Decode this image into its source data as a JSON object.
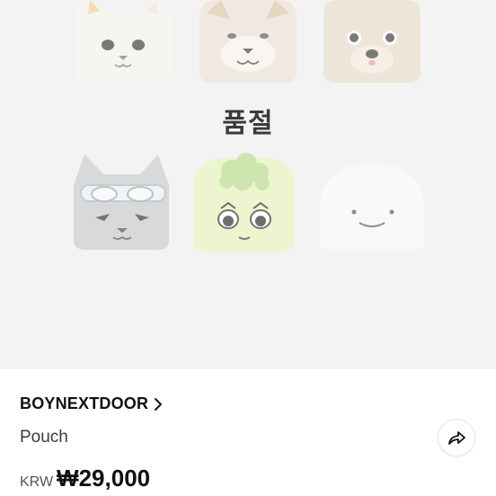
{
  "product": {
    "soldout_label": "품절",
    "brand": "BOYNEXTDOOR",
    "name": "Pouch",
    "currency": "KRW",
    "price": "₩29,000"
  },
  "icons": {
    "brand_chevron": "chevron-right-icon",
    "share": "share-icon"
  },
  "colors": {
    "image_background": "#eeeeee",
    "text_primary": "#111111"
  }
}
